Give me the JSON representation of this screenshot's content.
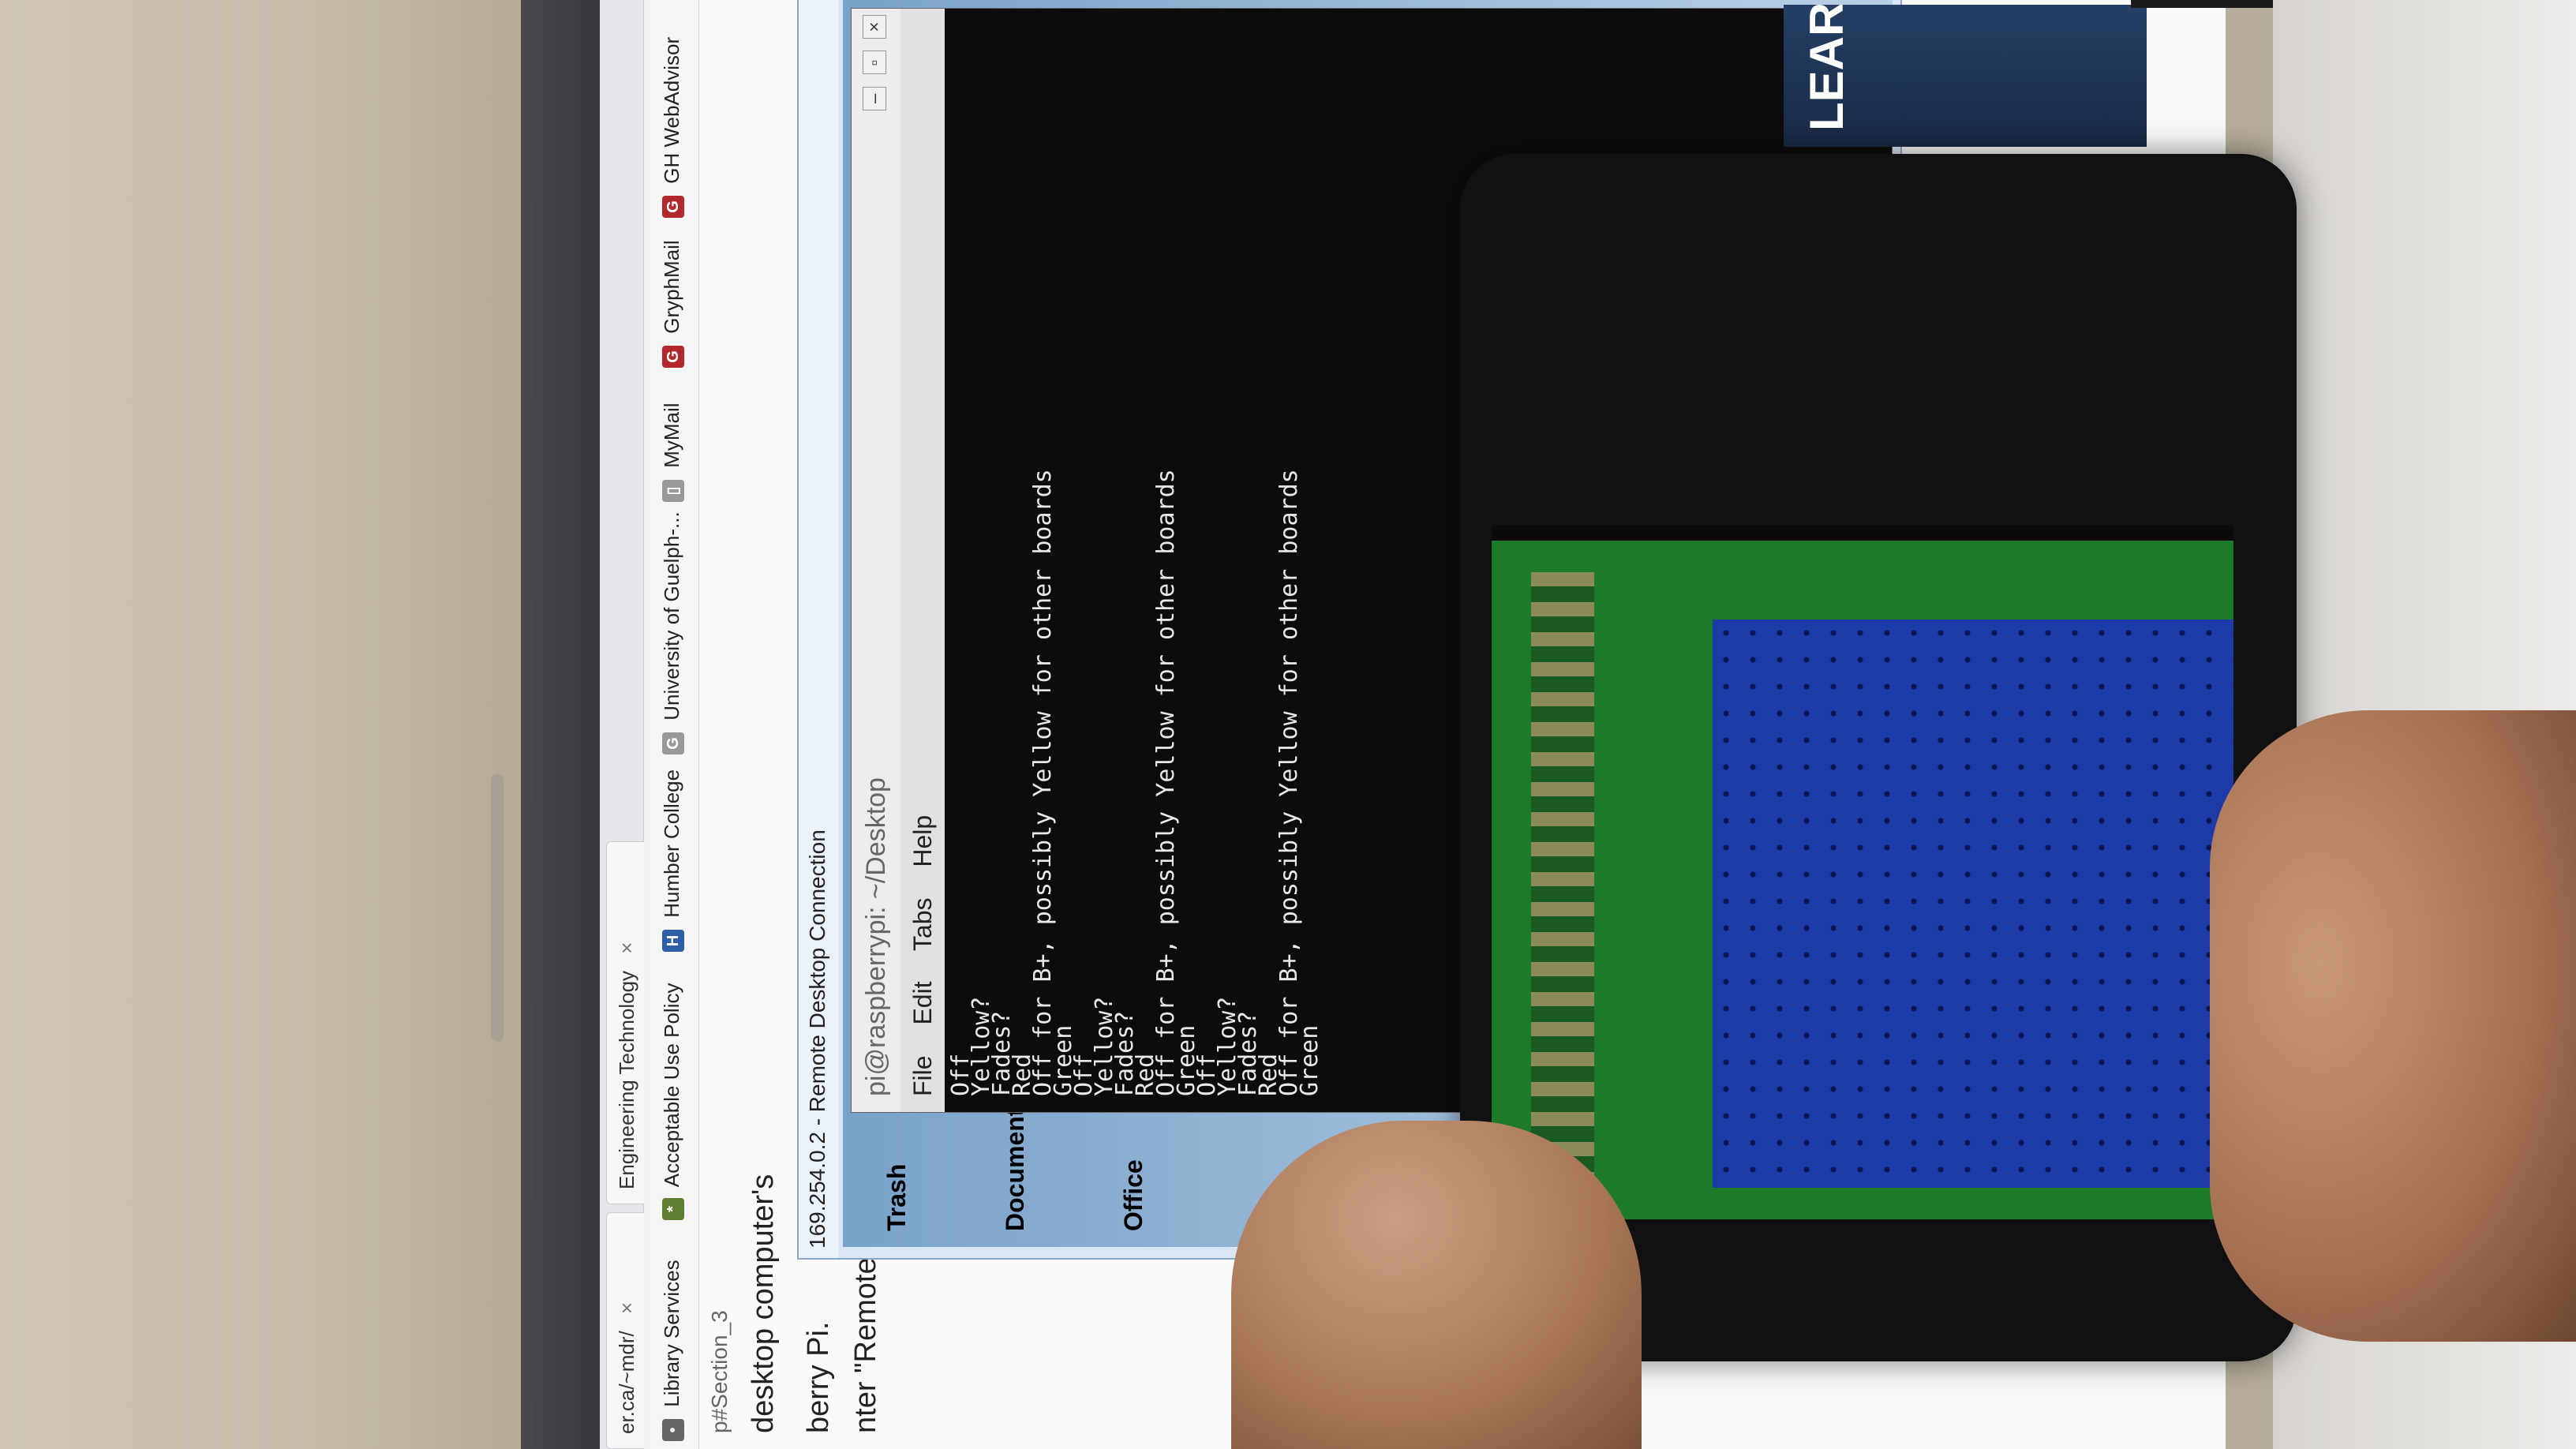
{
  "browser": {
    "tabs": [
      {
        "label": "er.ca/~mdr/",
        "close": "×"
      },
      {
        "label": "Engineering Technology",
        "close": "×"
      }
    ],
    "address_fragment": "p#Section_3",
    "bookmarks": [
      {
        "label": "Library Services",
        "icon_color": "#666"
      },
      {
        "label": "Acceptable Use Policy",
        "icon_color": "#5e7f2f"
      },
      {
        "label": "Humber College",
        "icon_color": "#2c5fa8"
      },
      {
        "label": "University of Guelph-...",
        "icon_color": "#999"
      },
      {
        "label": "MyMail",
        "icon_color": "#999"
      },
      {
        "label": "GryphMail",
        "icon_color": "#b3282d"
      },
      {
        "label": "GH WebAdvisor",
        "icon_color": "#b3282d"
      }
    ],
    "page_lines": [
      "desktop computer's",
      "berry Pi.",
      "nter \"Remote Desktop"
    ]
  },
  "rdc": {
    "title": "169.254.0.2 - Remote Desktop Connection",
    "desktop_icons": [
      "Trash",
      "Documents",
      "Office"
    ],
    "terminal": {
      "title": "pi@raspberrypi: ~/Desktop",
      "menu": [
        "File",
        "Edit",
        "Tabs",
        "Help"
      ],
      "lines": [
        "Off",
        "Yellow?",
        "Fades?",
        "Red",
        "Off for B+, possibly Yellow for other boards",
        "Green",
        "Off",
        "Yellow?",
        "Fades?",
        "Red",
        "Off for B+, possibly Yellow for other boards",
        "Green",
        "Off",
        "Yellow?",
        "Fades?",
        "Red",
        "Off for B+, possibly Yellow for other boards",
        "Green"
      ]
    }
  },
  "banner": {
    "text": "LEARN"
  },
  "colors": {
    "led": "#e1182a",
    "breadboard": "#1c3aa8",
    "pcb": "#1e7a2b"
  }
}
